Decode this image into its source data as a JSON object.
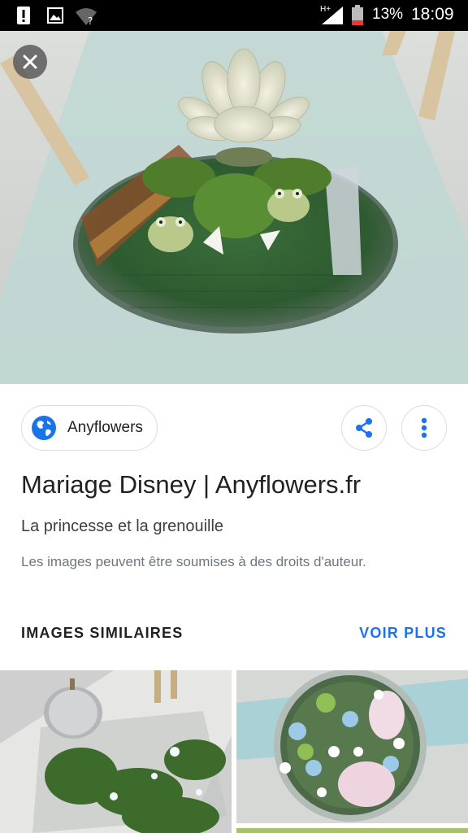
{
  "status_bar": {
    "battery_percent": "13%",
    "time": "18:09",
    "network_label": "H+",
    "icons": [
      "alert-icon",
      "gallery-icon",
      "wifi-question-icon",
      "signal-icon",
      "battery-icon"
    ]
  },
  "viewer": {
    "close_icon": "close-icon"
  },
  "source": {
    "label": "Anyflowers",
    "icon": "globe-icon"
  },
  "actions": {
    "share_icon": "share-icon",
    "more_icon": "more-vert-icon"
  },
  "result": {
    "title": "Mariage Disney | Anyflowers.fr",
    "subtitle": "La princesse et la grenouille",
    "notice": "Les images peuvent être soumises à des droits d'auteur."
  },
  "similar": {
    "heading": "IMAGES SIMILAIRES",
    "see_more": "VOIR PLUS"
  },
  "colors": {
    "accent": "#1a73e8",
    "status_bar": "#000000"
  }
}
